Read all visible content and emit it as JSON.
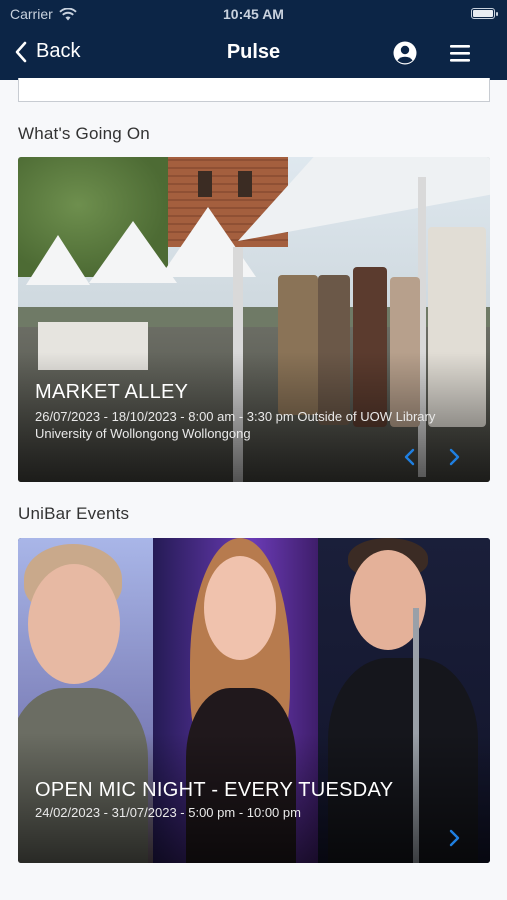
{
  "status_bar": {
    "carrier": "Carrier",
    "time": "10:45 AM"
  },
  "nav": {
    "back_label": "Back",
    "title": "Pulse"
  },
  "sections": [
    {
      "title": "What's Going On",
      "card": {
        "title": "MARKET ALLEY",
        "meta": "26/07/2023 - 18/10/2023 - 8:00 am - 3:30 pm Outside of UOW Library University of Wollongong Wollongong"
      }
    },
    {
      "title": "UniBar Events",
      "card": {
        "title": "OPEN MIC NIGHT - EVERY TUESDAY",
        "meta": "24/02/2023 - 31/07/2023 - 5:00 pm - 10:00 pm"
      }
    }
  ],
  "colors": {
    "nav_bg": "#0c2546",
    "chevron": "#1f7fe0",
    "page_bg": "#f7f8fa"
  },
  "icons": [
    "wifi-icon",
    "battery-icon",
    "back-chevron-icon",
    "profile-icon",
    "menu-icon",
    "chevron-left-icon",
    "chevron-right-icon"
  ]
}
